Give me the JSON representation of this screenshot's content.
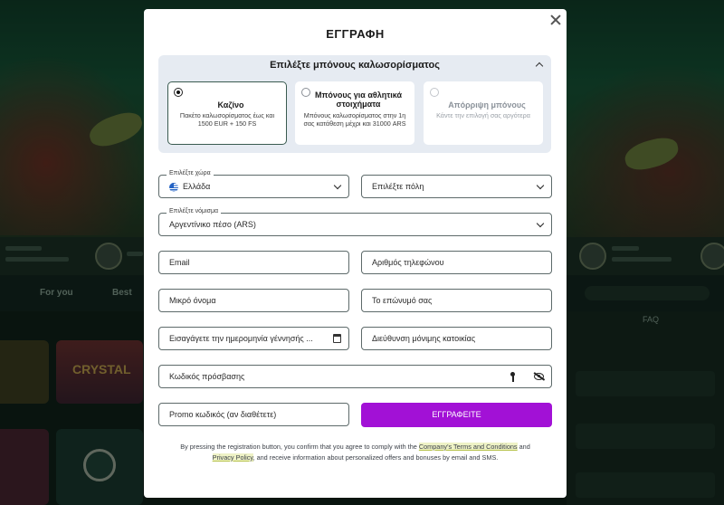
{
  "modal": {
    "title": "ΕΓΓΡΑΦΗ",
    "close_icon": "close-icon"
  },
  "bonus": {
    "header": "Επιλέξτε μπόνους καλωσορίσματος",
    "options": [
      {
        "title": "Καζίνο",
        "desc": "Πακέτο καλωσορίσματος έως και 1500 EUR + 150 FS",
        "selected": true
      },
      {
        "title": "Μπόνους για αθλητικά στοιχήματα",
        "desc": "Μπόνους καλωσορίσματος στην 1η σας κατάθεση μέχρι και 31000 ARS",
        "selected": false
      },
      {
        "title": "Απόρριψη μπόνους",
        "desc": "Κάντε την επιλογή σας αργότερα",
        "selected": false
      }
    ]
  },
  "form": {
    "country_label": "Επιλέξτε χώρα",
    "country_value": "Ελλάδα",
    "city_placeholder": "Επιλέξτε πόλη",
    "currency_label": "Επιλέξτε νόμισμα",
    "currency_value": "Αργεντίνικο πέσο (ARS)",
    "email": "Email",
    "phone": "Αριθμός τηλεφώνου",
    "first_name": "Μικρό όνομα",
    "last_name": "Το επώνυμό σας",
    "birthdate": "Εισαγάγετε την ημερομηνία γέννησής ...",
    "address": "Διεύθυνση μόνιμης κατοικίας",
    "password": "Κωδικός πρόσβασης",
    "promo": "Promo κωδικός (αν διαθέτετε)",
    "submit": "ΕΓΓΡΑΦΕΙΤΕ"
  },
  "terms": {
    "before": "By pressing the registration button, you confirm that you agree to comply with the ",
    "link1": "Company's Terms and Conditions",
    "middle": " and ",
    "link2": "Privacy Policy",
    "after": ", and receive information about personalized offers and bonuses by email and SMS."
  },
  "background": {
    "tab_for_you": "For you",
    "tab_best": "Best",
    "faq": "FAQ",
    "game_crystal": "CRYSTAL"
  },
  "colors": {
    "accent_purple": "#a211d6",
    "bonus_panel": "#e6ebf2",
    "field_border": "#5d6a6a"
  }
}
